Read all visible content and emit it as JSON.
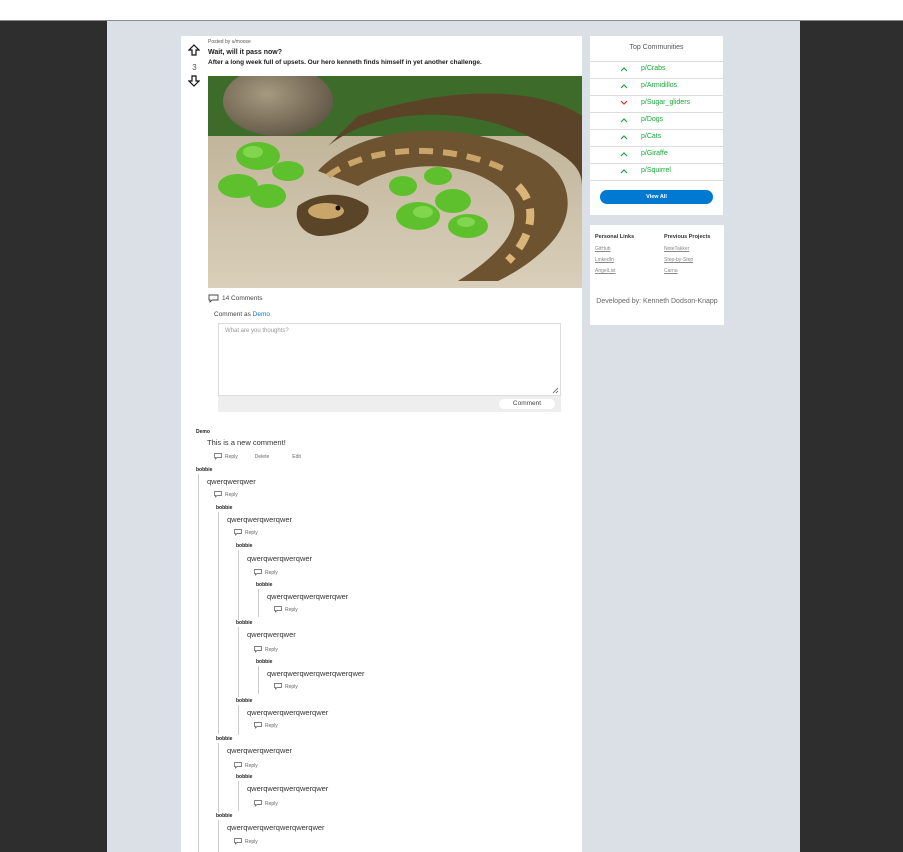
{
  "post": {
    "score": "3",
    "posted_by": "Posted by u/moose",
    "title": "Wait, will it pass now?",
    "subtitle": "After a long week full of upsets. Our hero kenneth finds himself in yet another challenge.",
    "comments_count": "14 Comments",
    "comment_as_prefix": "Comment as ",
    "comment_as_user": "Demo",
    "textarea_placeholder": "What are you thoughts?",
    "comment_button": "Comment"
  },
  "comments": [
    {
      "author": "Demo",
      "body": "This is a new comment!",
      "reply": "Reply",
      "delete": "Delete",
      "edit": "Edit"
    },
    {
      "author": "bobbie",
      "body": "qwerqwerqwer",
      "reply": "Reply"
    },
    {
      "author": "bobbie",
      "body": "qwerqwerqwerqwer",
      "reply": "Reply"
    },
    {
      "author": "bobbie",
      "body": "qwerqwerqwerqwer",
      "reply": "Reply"
    },
    {
      "author": "bobbie",
      "body": "qwerqwerqwerqwerqwer",
      "reply": "Reply"
    },
    {
      "author": "bobbie",
      "body": "qwerqwerqwer",
      "reply": "Reply"
    },
    {
      "author": "bobbie",
      "body": "qwerqwerqwerqwerqwerqwer",
      "reply": "Reply"
    },
    {
      "author": "bobbie",
      "body": "qwerqwerqwerqwerqwer",
      "reply": "Reply"
    },
    {
      "author": "bobbie",
      "body": "qwerqwerqwerqwer",
      "reply": "Reply"
    },
    {
      "author": "bobbie",
      "body": "qwerqwerqwerqwerqwer",
      "reply": "Reply"
    },
    {
      "author": "bobbie",
      "body": "qwerqwerqwerqwerqwerqwer",
      "reply": "Reply"
    }
  ],
  "sidebar": {
    "top_title": "Top Communities",
    "communities": [
      {
        "name": "p/Crabs",
        "trend": "up"
      },
      {
        "name": "p/Armidillos",
        "trend": "up"
      },
      {
        "name": "p/Sugar_gliders",
        "trend": "down"
      },
      {
        "name": "p/Dogs",
        "trend": "up"
      },
      {
        "name": "p/Cats",
        "trend": "up"
      },
      {
        "name": "p/Giraffe",
        "trend": "up"
      },
      {
        "name": "p/Squirrel",
        "trend": "up"
      }
    ],
    "view_all": "View All",
    "personal_links_title": "Personal Links",
    "personal_links": [
      "GitHub",
      "LinkedIn",
      "AngelList"
    ],
    "previous_projects_title": "Previous Projects",
    "previous_projects": [
      "NoteTakker",
      "Step-by-Step",
      "Carna"
    ],
    "developed_by": "Developed by: Kenneth Dodson-Knapp"
  },
  "colors": {
    "accent": "#0079d3",
    "up": "#19a83a",
    "down": "#e0301e"
  }
}
